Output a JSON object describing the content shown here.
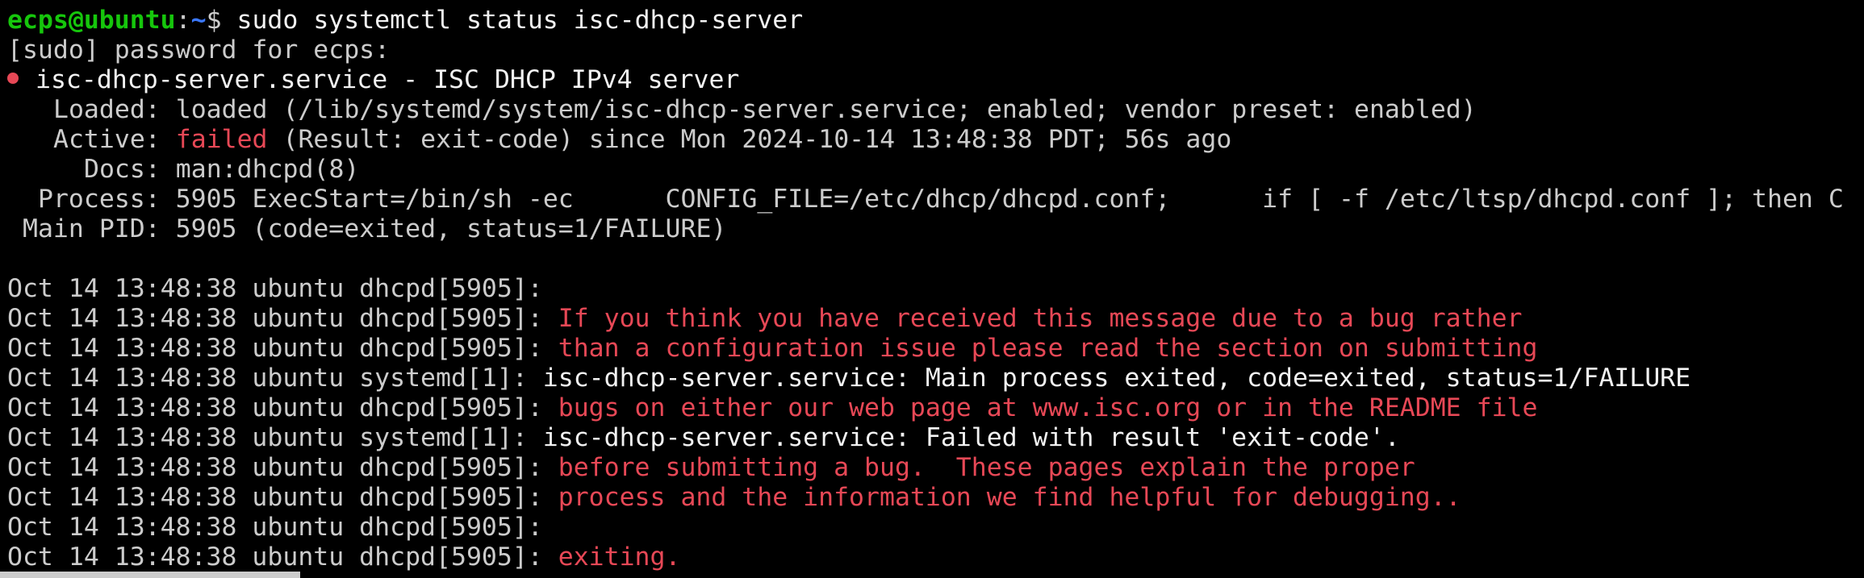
{
  "prompt": {
    "user_host": "ecps@ubuntu",
    "separator": ":",
    "path": "~",
    "symbol": "$",
    "command": " sudo systemctl status isc-dhcp-server"
  },
  "sudo_prompt": "[sudo] password for ecps:",
  "unit": {
    "title": "isc-dhcp-server.service - ISC DHCP IPv4 server",
    "loaded_label": "Loaded:",
    "loaded_value": " loaded (/lib/systemd/system/isc-dhcp-server.service; enabled; vendor preset: enabled)",
    "active_label": "Active:",
    "active_state": "failed",
    "active_rest": " (Result: exit-code) since Mon 2024-10-14 13:48:38 PDT; 56s ago",
    "docs_label": "Docs:",
    "docs_value": " man:dhcpd(8)",
    "process_label": "Process:",
    "process_value": " 5905 ExecStart=/bin/sh -ec      CONFIG_FILE=/etc/dhcp/dhcpd.conf;      if [ -f /etc/ltsp/dhcpd.conf ]; then C",
    "mainpid_label": "Main PID:",
    "mainpid_value": " 5905 (code=exited, status=1/FAILURE)"
  },
  "log": [
    {
      "prefix": "Oct 14 13:48:38 ubuntu dhcpd[5905]:",
      "message": "",
      "level": "red"
    },
    {
      "prefix": "Oct 14 13:48:38 ubuntu dhcpd[5905]:",
      "message": " If you think you have received this message due to a bug rather",
      "level": "red"
    },
    {
      "prefix": "Oct 14 13:48:38 ubuntu dhcpd[5905]:",
      "message": " than a configuration issue please read the section on submitting",
      "level": "red"
    },
    {
      "prefix": "Oct 14 13:48:38 ubuntu systemd[1]:",
      "message": " isc-dhcp-server.service: Main process exited, code=exited, status=1/FAILURE",
      "level": "white"
    },
    {
      "prefix": "Oct 14 13:48:38 ubuntu dhcpd[5905]:",
      "message": " bugs on either our web page at www.isc.org or in the README file",
      "level": "red"
    },
    {
      "prefix": "Oct 14 13:48:38 ubuntu systemd[1]:",
      "message": " isc-dhcp-server.service: Failed with result 'exit-code'.",
      "level": "white"
    },
    {
      "prefix": "Oct 14 13:48:38 ubuntu dhcpd[5905]:",
      "message": " before submitting a bug.  These pages explain the proper",
      "level": "red"
    },
    {
      "prefix": "Oct 14 13:48:38 ubuntu dhcpd[5905]:",
      "message": " process and the information we find helpful for debugging..",
      "level": "red"
    },
    {
      "prefix": "Oct 14 13:48:38 ubuntu dhcpd[5905]:",
      "message": "",
      "level": "red"
    },
    {
      "prefix": "Oct 14 13:48:38 ubuntu dhcpd[5905]:",
      "message": " exiting.",
      "level": "red"
    }
  ],
  "colors": {
    "background": "#000000",
    "prompt_user": "#16c60c",
    "prompt_path": "#3b78ff",
    "error": "#e74856",
    "text": "#cccccc",
    "bright_text": "#f2f2f2"
  }
}
